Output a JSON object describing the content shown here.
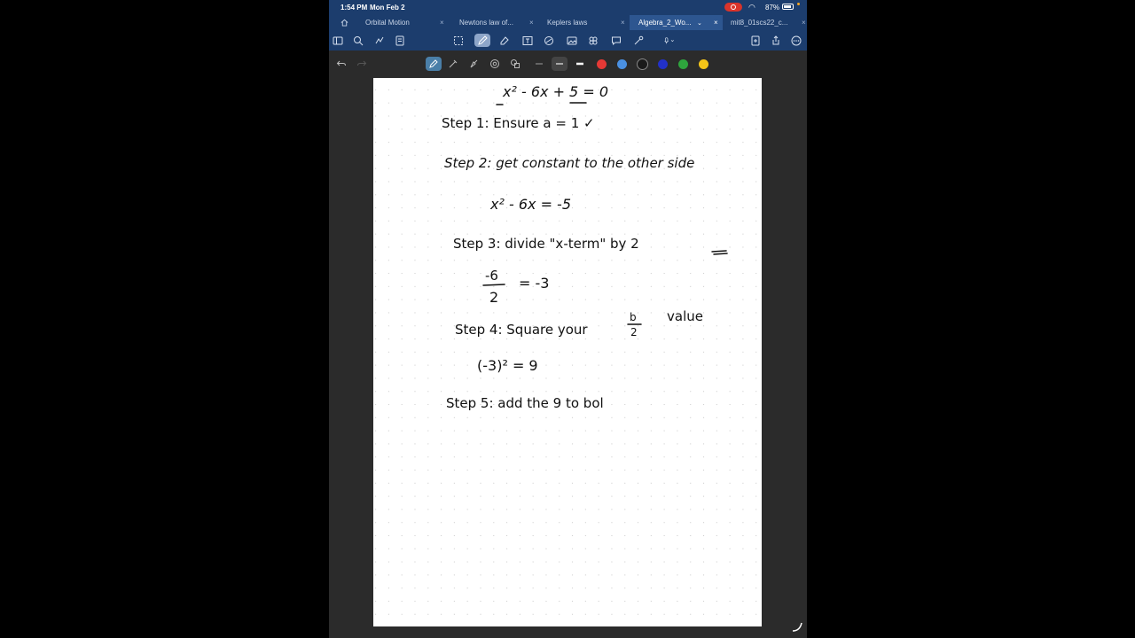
{
  "status_bar": {
    "time": "1:54 PM",
    "date": "Mon Feb 2",
    "battery": "87%"
  },
  "tabs": [
    {
      "label": "Orbital Motion",
      "active": false
    },
    {
      "label": "Newtons law of...",
      "active": false
    },
    {
      "label": "Keplers laws",
      "active": false
    },
    {
      "label": "Algebra_2_Wo...",
      "active": true
    },
    {
      "label": "mit8_01scs22_c...",
      "active": false
    }
  ],
  "toolbar": {
    "icons": [
      "sidebar-icon",
      "search-icon",
      "bookmark-icon",
      "document-icon",
      "lasso-select-icon",
      "pen-icon",
      "eraser-icon",
      "text-box-icon",
      "shapes-icon",
      "image-icon",
      "sticker-icon",
      "comment-icon",
      "laser-pointer-icon",
      "microphone-icon",
      "upload-icon",
      "share-icon",
      "more-icon"
    ]
  },
  "pen_colors": [
    "#1a1a1a",
    "#e53935",
    "#4a90e2",
    "#2b2b2b",
    "#2231c7",
    "#2ea43d",
    "#f5c518"
  ],
  "notes": {
    "line0": "x² - 6x + 5 = 0",
    "line1": "Step 1: Ensure  a = 1 ✓",
    "line2": "Step 2: get constant to the other side",
    "line3": "x² - 6x = -5",
    "line4": "Step 3: divide \"x-term\" by 2",
    "line5_num": "-6",
    "line5_den": "2",
    "line5_rest": "= -3",
    "line6_a": "Step 4: Square your",
    "line6_num": "b",
    "line6_den": "2",
    "line6_b": "value",
    "line7": "(-3)² = 9",
    "line8": "Step 5: add the 9 to bol"
  },
  "accent": "#1c3d6d"
}
